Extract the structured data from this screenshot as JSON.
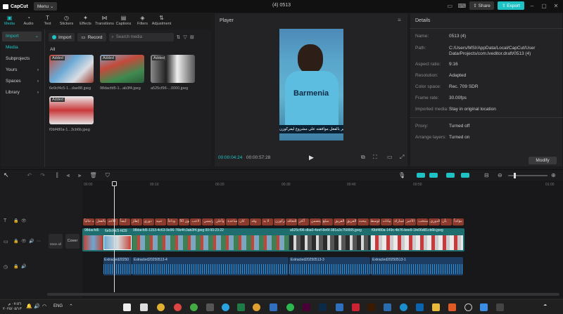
{
  "app": {
    "name": "CapCut",
    "menu_label": "Menu",
    "project_title": "(4) 0513",
    "share_label": "Share",
    "export_label": "Export"
  },
  "tool_tabs": [
    {
      "label": "Media",
      "icon": "media-icon"
    },
    {
      "label": "Audio",
      "icon": "audio-icon"
    },
    {
      "label": "Text",
      "icon": "text-icon"
    },
    {
      "label": "Stickers",
      "icon": "sticker-icon"
    },
    {
      "label": "Effects",
      "icon": "effects-icon"
    },
    {
      "label": "Transitions",
      "icon": "transitions-icon"
    },
    {
      "label": "Captions",
      "icon": "captions-icon"
    },
    {
      "label": "Filters",
      "icon": "filters-icon"
    },
    {
      "label": "Adjustment",
      "icon": "adjustment-icon"
    }
  ],
  "sidebar": {
    "items": [
      {
        "label": "Import"
      },
      {
        "label": "Media"
      },
      {
        "label": "Subprojects"
      },
      {
        "label": "Yours"
      },
      {
        "label": "Spaces"
      },
      {
        "label": "Library"
      }
    ]
  },
  "media": {
    "import_label": "Import",
    "record_label": "Record",
    "search_placeholder": "Search media",
    "filter_all": "All",
    "items": [
      {
        "badge": "Added",
        "name": "6e9cf4c5-1...dae88.jpeg"
      },
      {
        "badge": "Added",
        "name": "98dacfd5-1...ab3f4.jpeg"
      },
      {
        "badge": "Added",
        "name": "a525cf96-...0000.jpeg"
      },
      {
        "badge": "Added",
        "name": "f0bf480a-1...3cb6b.jpeg"
      }
    ]
  },
  "player": {
    "title": "Player",
    "caption": "أسطير بالفعل موافقته على مشروع ليفركوزن",
    "jersey_text": "Barmenia",
    "current_time": "00:00:04:24",
    "total_time": "00:00:57:28"
  },
  "details": {
    "title": "Details",
    "rows": [
      {
        "key": "Name:",
        "value": "0513 (4)"
      },
      {
        "key": "Path:",
        "value": "C:/Users/MSI/AppData/Local/CapCut/User Data/Projects/com.lveditor.draft/0513 (4)"
      },
      {
        "key": "Aspect ratio:",
        "value": "9:16"
      },
      {
        "key": "Resolution:",
        "value": "Adapted"
      },
      {
        "key": "Color space:",
        "value": "Rec. 709 SDR"
      },
      {
        "key": "Frame rate:",
        "value": "30.00fps"
      },
      {
        "key": "Imported media:",
        "value": "Stay in original location"
      },
      {
        "key": "Proxy:",
        "value": "Turned off"
      },
      {
        "key": "Arrange layers:",
        "value": "Turned on"
      }
    ],
    "modify_label": "Modify"
  },
  "timeline": {
    "ruler": [
      "00:00",
      "00:10",
      "00:20",
      "00:30",
      "00:40",
      "00:50",
      "01:00"
    ],
    "text_clips": [
      "أعلنت حالياً",
      "أغسطس بالفعل",
      "الأحد",
      "أيضاً",
      "إطار",
      "دوري",
      "تنبيه",
      "وداعاً",
      "50 مليون",
      "لاعب",
      "رئيسي",
      "وأعلن",
      "مساعدة",
      "كان",
      "وقد",
      "لا بد",
      "ليفركوزن",
      "للتعاقد",
      "أكثر",
      "يتضمن",
      "مبلغ",
      "الفريق",
      "مدرب الفريق",
      "يبحث",
      "لاعب الوسط",
      "بيانات",
      "المباراة",
      "الأخير",
      "المنتخب",
      "الدوري",
      "بأن",
      "مؤكداً"
    ],
    "video_clips": [
      {
        "name": "98dacfd5"
      },
      {
        "name": "6e9cf4c5-fd39"
      },
      {
        "name": "98dacfd5-1153-4c63-9e96-76b4fc3ab3f4.jpeg  00:00:23:22"
      },
      {
        "name": "a525cf96-dba0-4eef-8e6f-381a3c750005.jpeg"
      },
      {
        "name": "f0bf480a-149c-4b76-bee9-1fe06d81cb6b.jpeg"
      }
    ],
    "audio_clips": [
      {
        "name": "Extracted20250"
      },
      {
        "name": "Extracted20250513-4"
      },
      {
        "name": "Extracted20250513-3"
      },
      {
        "name": "Extracted20250513-1"
      }
    ],
    "cover_label": "Cover",
    "mute_label": "Mute all"
  },
  "taskbar": {
    "time": "٠٧:٥٦ م",
    "date": "٢٠٢٥/٠٥/١٣",
    "lang": "ENG"
  },
  "colors": {
    "accent": "#1fc2c4",
    "text_clip": "#8b3a2b",
    "video_track": "#1e6e70",
    "audio_track": "#1d3d63"
  }
}
